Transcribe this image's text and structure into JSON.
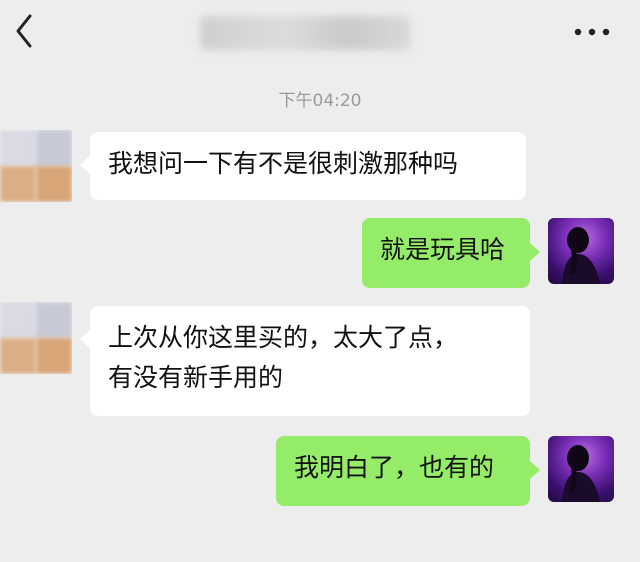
{
  "header": {
    "back_icon": "chevron-left-icon",
    "more_icon": "more-dots-icon"
  },
  "timestamp": "下午04:20",
  "messages": [
    {
      "side": "left",
      "text": "我想问一下有不是很刺激那种吗"
    },
    {
      "side": "right",
      "text": "就是玩具哈"
    },
    {
      "side": "left",
      "line1": "上次从你这里买的，太大了点，",
      "line2": "有没有新手用的"
    },
    {
      "side": "right",
      "text": "我明白了，也有的"
    }
  ],
  "colors": {
    "background": "#ededed",
    "bubble_left": "#ffffff",
    "bubble_right": "#95ec69",
    "timestamp": "#9a9a9a"
  }
}
